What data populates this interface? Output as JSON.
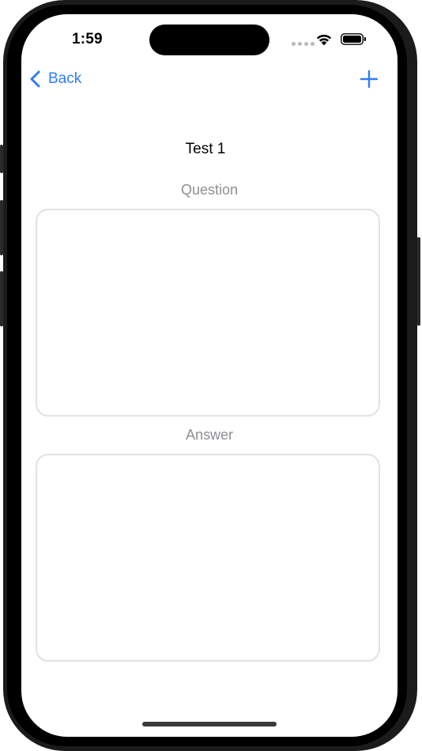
{
  "status_bar": {
    "time": "1:59"
  },
  "nav": {
    "back_label": "Back",
    "add_icon": "plus-icon",
    "back_icon": "chevron-left-icon"
  },
  "card": {
    "title": "Test 1"
  },
  "question": {
    "label": "Question",
    "value": ""
  },
  "answer": {
    "label": "Answer",
    "value": ""
  },
  "colors": {
    "accent": "#2f7cf6",
    "label_gray": "#8e8e93",
    "field_border": "#e2e2e4"
  }
}
